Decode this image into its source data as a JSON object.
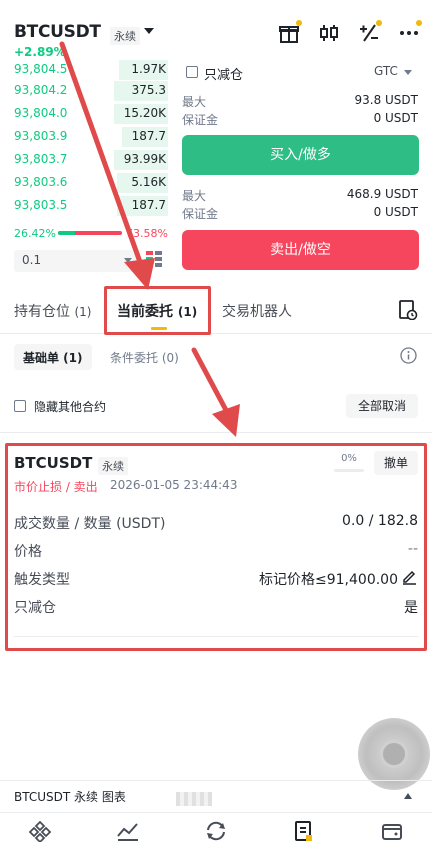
{
  "header": {
    "pair": "BTCUSDT",
    "contract": "永续",
    "change": "+2.89%"
  },
  "orderbook": {
    "rows": [
      {
        "price": "93,804.5",
        "qty": "1.97K",
        "depth": 0.32
      },
      {
        "price": "93,804.2",
        "qty": "375.3",
        "depth": 0.35
      },
      {
        "price": "93,804.0",
        "qty": "15.20K",
        "depth": 0.35
      },
      {
        "price": "93,803.9",
        "qty": "187.7",
        "depth": 0.3
      },
      {
        "price": "93,803.7",
        "qty": "93.99K",
        "depth": 0.35
      },
      {
        "price": "93,803.6",
        "qty": "5.16K",
        "depth": 0.33
      },
      {
        "price": "93,803.5",
        "qty": "187.7",
        "depth": 0.33
      }
    ],
    "buy_ratio": "26.42%",
    "sell_ratio": "73.58%",
    "buy_fraction": 0.2642,
    "depth_value": "0.1"
  },
  "trade_panel": {
    "reduce_only": "只减仓",
    "tif": "GTC",
    "max_label": "最大",
    "margin_label": "保证金",
    "buy_max": "93.8 USDT",
    "buy_margin": "0 USDT",
    "buy_label": "买入/做多",
    "sell_max": "468.9 USDT",
    "sell_margin": "0 USDT",
    "sell_label": "卖出/做空"
  },
  "tabs": {
    "positions": "持有仓位",
    "positions_count": "(1)",
    "orders": "当前委托",
    "orders_count": "(1)",
    "bots": "交易机器人"
  },
  "subtabs": {
    "basic": "基础单 (1)",
    "conditional": "条件委托 (0)"
  },
  "filter": {
    "hide_other": "隐藏其他合约",
    "cancel_all": "全部取消"
  },
  "order": {
    "pair": "BTCUSDT",
    "contract": "永续",
    "type": "市价止损 / 卖出",
    "time": "2026-01-05 23:44:43",
    "progress": "0%",
    "cancel": "撤单",
    "filled_label": "成交数量 / 数量 (USDT)",
    "filled_value": "0.0 / 182.8",
    "price_label": "价格",
    "price_value": "--",
    "trigger_label": "触发类型",
    "trigger_value": "标记价格≤91,400.00",
    "reduce_label": "只减仓",
    "reduce_value": "是"
  },
  "bottom": {
    "text": "BTCUSDT 永续  图表"
  },
  "colors": {
    "green": "#0ecb81",
    "red": "#f6465d",
    "accent": "#f0b90b",
    "annotation": "#e14a4a"
  }
}
